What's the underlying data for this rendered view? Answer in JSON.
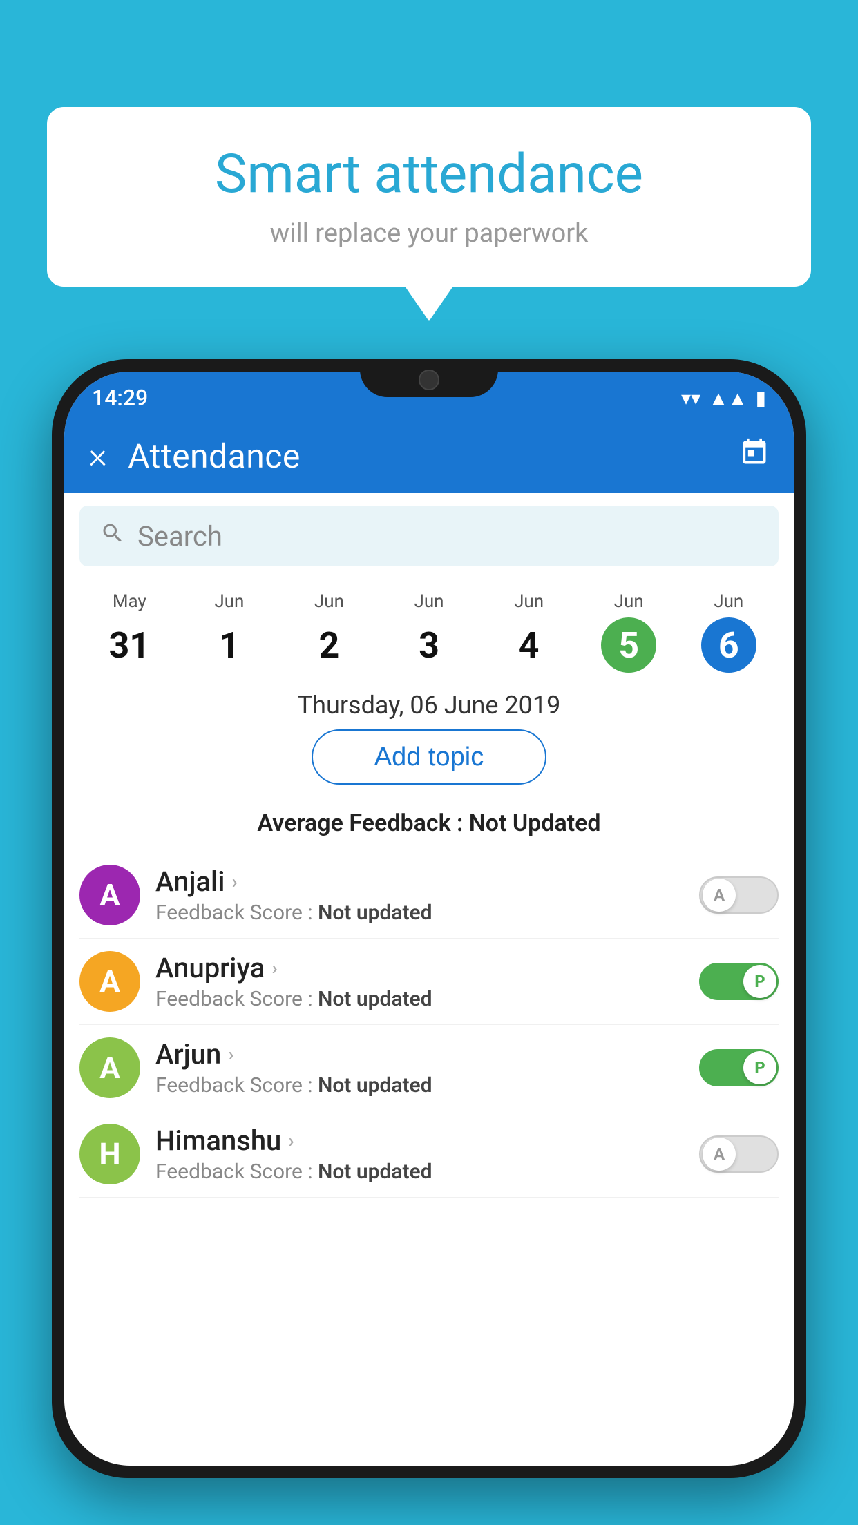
{
  "background_color": "#29b6d8",
  "bubble": {
    "title": "Smart attendance",
    "subtitle": "will replace your paperwork"
  },
  "status_bar": {
    "time": "14:29",
    "wifi": "▼",
    "signal": "▲",
    "battery": "▮"
  },
  "app_bar": {
    "title": "Attendance",
    "close_label": "×",
    "calendar_label": "📅"
  },
  "search": {
    "placeholder": "Search"
  },
  "calendar": {
    "days": [
      {
        "month": "May",
        "number": "31",
        "state": "normal"
      },
      {
        "month": "Jun",
        "number": "1",
        "state": "normal"
      },
      {
        "month": "Jun",
        "number": "2",
        "state": "normal"
      },
      {
        "month": "Jun",
        "number": "3",
        "state": "normal"
      },
      {
        "month": "Jun",
        "number": "4",
        "state": "normal"
      },
      {
        "month": "Jun",
        "number": "5",
        "state": "today"
      },
      {
        "month": "Jun",
        "number": "6",
        "state": "selected"
      }
    ]
  },
  "date_header": "Thursday, 06 June 2019",
  "add_topic_label": "Add topic",
  "avg_feedback_label": "Average Feedback :",
  "avg_feedback_value": "Not Updated",
  "students": [
    {
      "name": "Anjali",
      "avatar_letter": "A",
      "avatar_color": "#9c27b0",
      "feedback_label": "Feedback Score :",
      "feedback_value": "Not updated",
      "attendance": "absent",
      "toggle_letter": "A"
    },
    {
      "name": "Anupriya",
      "avatar_letter": "A",
      "avatar_color": "#f5a623",
      "feedback_label": "Feedback Score :",
      "feedback_value": "Not updated",
      "attendance": "present",
      "toggle_letter": "P"
    },
    {
      "name": "Arjun",
      "avatar_letter": "A",
      "avatar_color": "#8bc34a",
      "feedback_label": "Feedback Score :",
      "feedback_value": "Not updated",
      "attendance": "present",
      "toggle_letter": "P"
    },
    {
      "name": "Himanshu",
      "avatar_letter": "H",
      "avatar_color": "#8bc34a",
      "feedback_label": "Feedback Score :",
      "feedback_value": "Not updated",
      "attendance": "absent",
      "toggle_letter": "A"
    }
  ]
}
